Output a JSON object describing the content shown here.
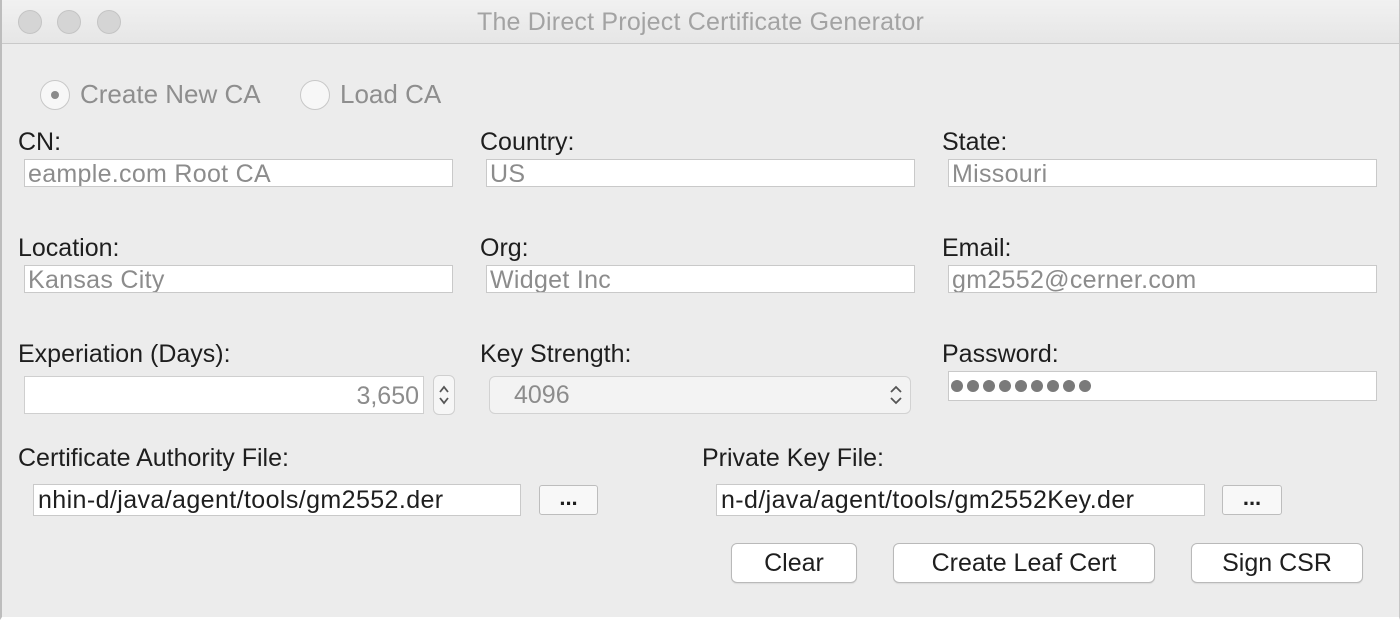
{
  "window": {
    "title": "The Direct Project Certificate Generator"
  },
  "mode": {
    "create_label": "Create New CA",
    "load_label": "Load CA",
    "selected": "create"
  },
  "form": {
    "cn": {
      "label": "CN:",
      "value": "eample.com Root CA"
    },
    "country": {
      "label": "Country:",
      "value": "US"
    },
    "state": {
      "label": "State:",
      "value": "Missouri"
    },
    "location": {
      "label": "Location:",
      "value": "Kansas City"
    },
    "org": {
      "label": "Org:",
      "value": "Widget Inc"
    },
    "email": {
      "label": "Email:",
      "value": "gm2552@cerner.com"
    },
    "expiration": {
      "label": "Experiation (Days):",
      "value": "3,650"
    },
    "key_strength": {
      "label": "Key Strength:",
      "value": "4096"
    },
    "password": {
      "label": "Password:",
      "masked_length": 9
    }
  },
  "files": {
    "ca_file": {
      "label": "Certificate Authority File:",
      "value": "nhin-d/java/agent/tools/gm2552.der",
      "browse_label": "..."
    },
    "key_file": {
      "label": "Private Key File:",
      "value": "n-d/java/agent/tools/gm2552Key.der",
      "browse_label": "..."
    }
  },
  "actions": {
    "clear_label": "Clear",
    "create_leaf_label": "Create Leaf Cert",
    "sign_csr_label": "Sign CSR"
  },
  "colors": {
    "window_bg": "#ececec",
    "disabled_text": "#8c8c8c",
    "label_text": "#1e1e1e"
  }
}
